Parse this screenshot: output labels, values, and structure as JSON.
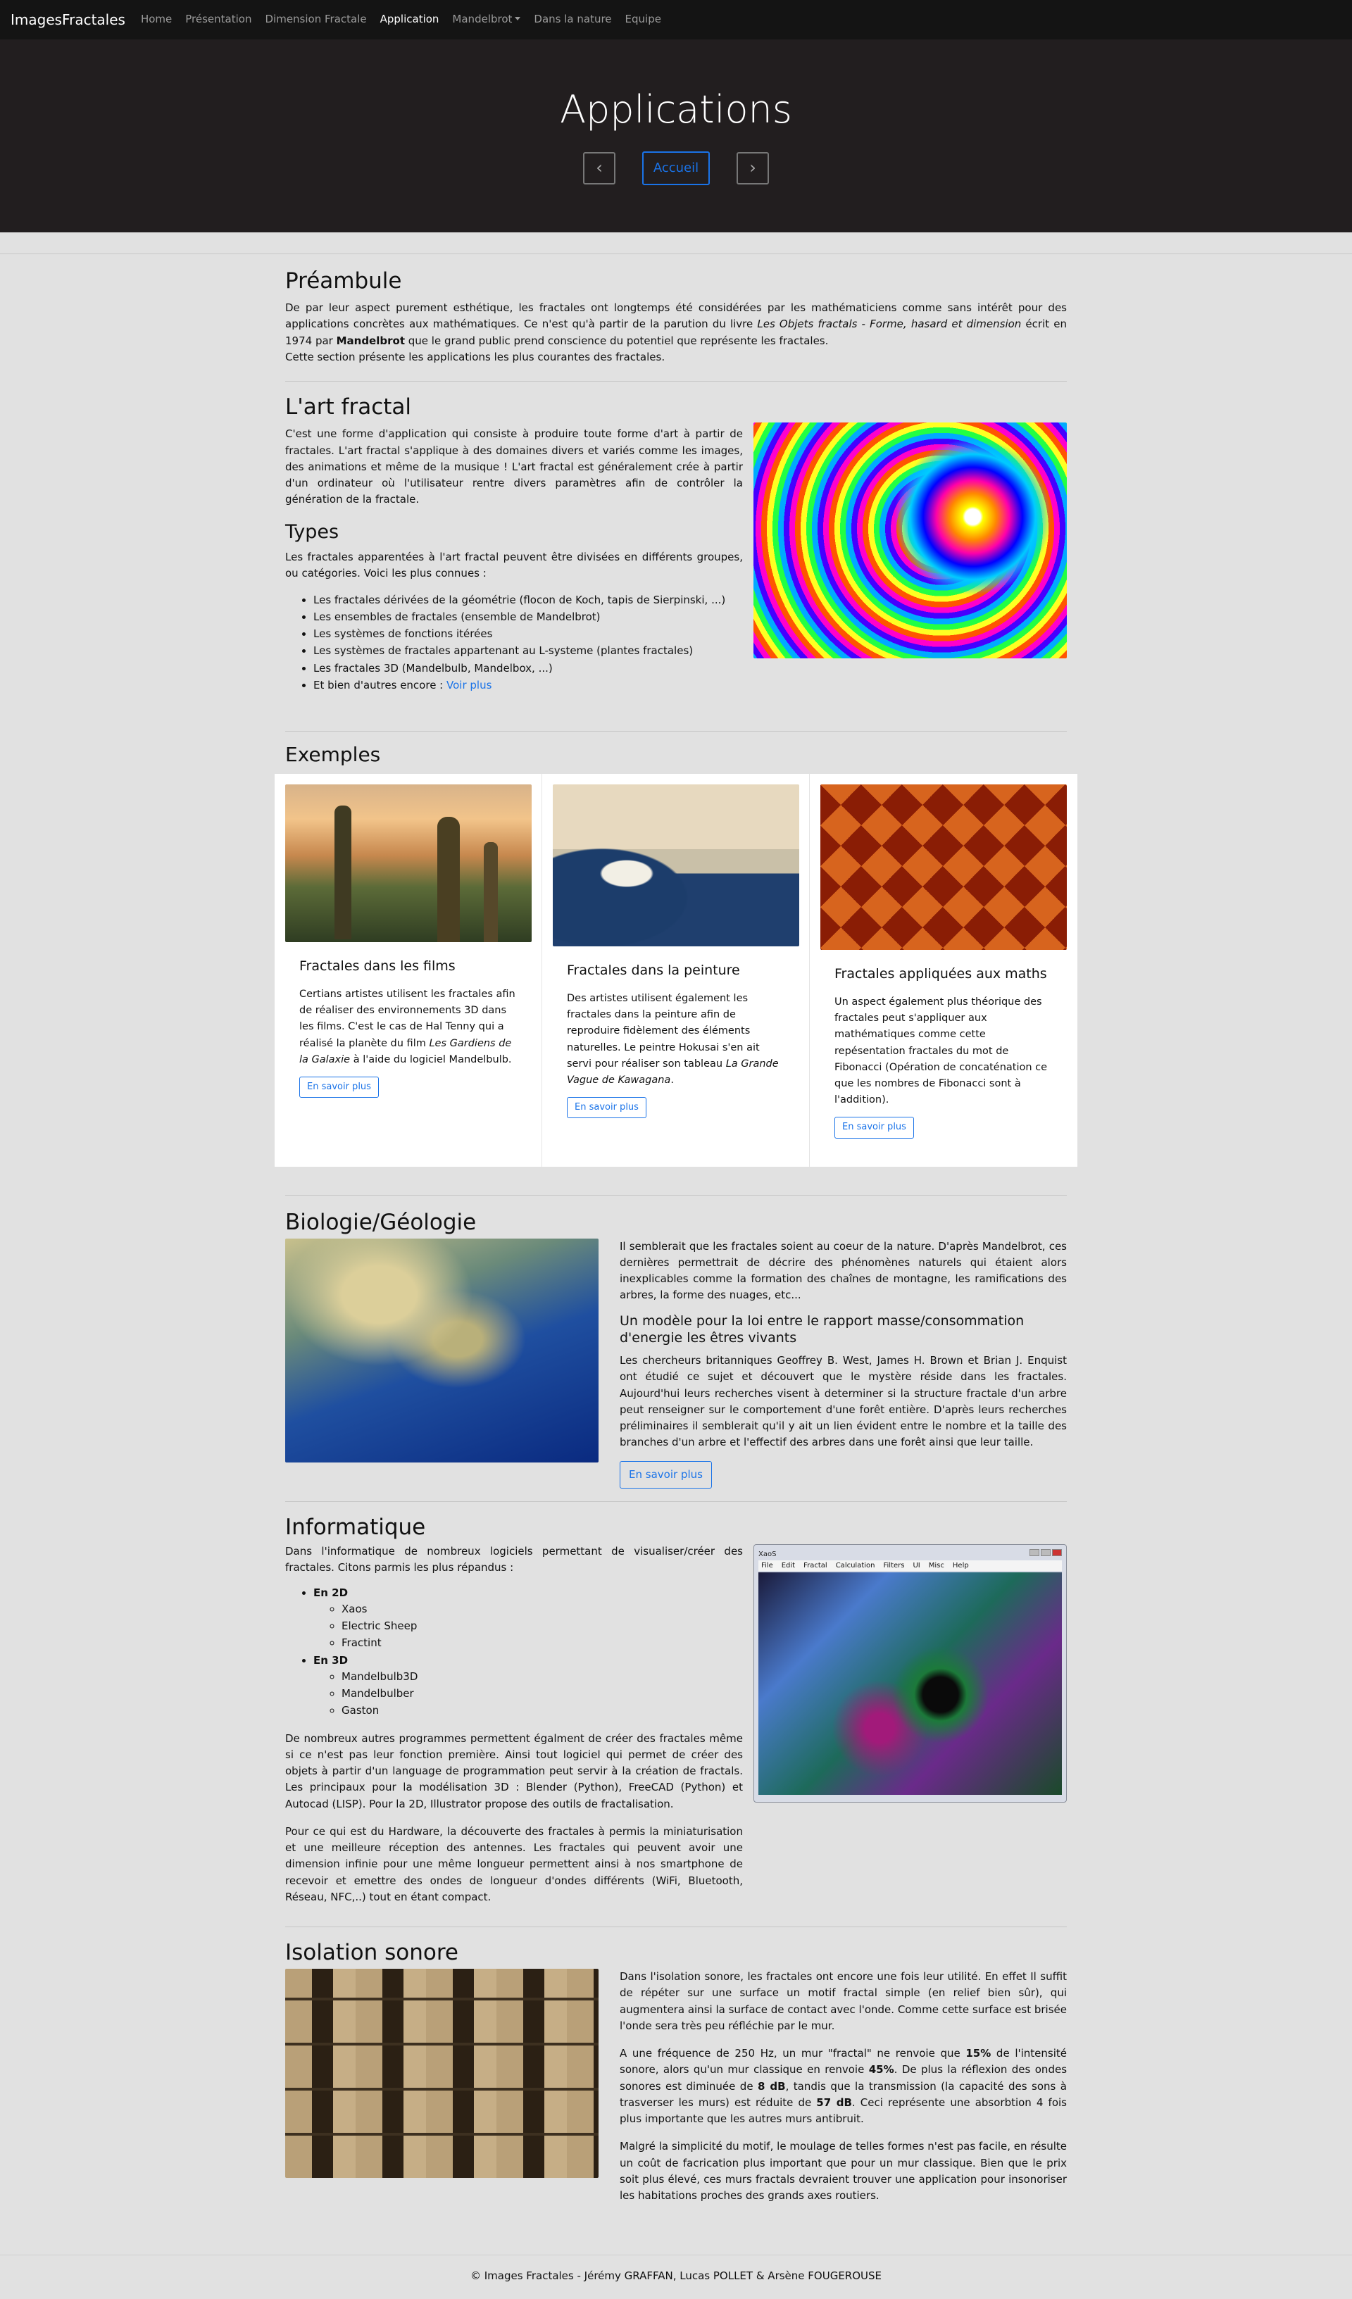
{
  "nav": {
    "brand": "ImagesFractales",
    "items": [
      "Home",
      "Présentation",
      "Dimension Fractale",
      "Application",
      "Mandelbrot",
      "Dans la nature",
      "Equipe"
    ]
  },
  "hero": {
    "title": "Applications",
    "prev": "‹",
    "home": "Accueil",
    "next": "›"
  },
  "preambule": {
    "title": "Préambule",
    "p1_a": "De par leur aspect purement esthétique, les fractales ont longtemps été considérées par les mathématiciens comme sans intérêt pour des applications concrètes aux mathématiques. Ce n'est qu'à partir de la parution du livre ",
    "p1_em": "Les Objets fractals - Forme, hasard et dimension",
    "p1_b": " écrit en 1974 par ",
    "p1_strong": "Mandelbrot",
    "p1_c": " que le grand public prend conscience du potentiel que représente les fractales.",
    "p2": "Cette section présente les applications les plus courantes des fractales."
  },
  "art": {
    "title": "L'art fractal",
    "p": "C'est une forme d'application qui consiste à produire toute forme d'art à partir de fractales. L'art fractal s'applique à des domaines divers et variés comme les images, des animations et même de la musique ! L'art fractal est généralement crée à partir d'un ordinateur où l'utilisateur rentre divers paramètres afin de contrôler la génération de la fractale.",
    "types_title": "Types",
    "types_p": "Les fractales apparentées à l'art fractal peuvent être divisées en différents groupes, ou catégories. Voici les plus connues :",
    "types": [
      "Les fractales dérivées de la géométrie (flocon de Koch, tapis de Sierpinski, ...)",
      "Les ensembles de fractales (ensemble de Mandelbrot)",
      "Les systèmes de fonctions itérées",
      "Les systèmes de fractales appartenant au L-systeme (plantes fractales)",
      "Les fractales 3D (Mandelbulb, Mandelbox, ...)"
    ],
    "more_text": "Et bien d'autres encore : ",
    "more_link": "Voir plus"
  },
  "exemples": {
    "title": "Exemples",
    "button": "En savoir plus",
    "films": {
      "title": "Fractales dans les films",
      "a": "Certians artistes utilisent les fractales afin de réaliser des environnements 3D dans les films. C'est le cas de Hal Tenny qui a réalisé la planète du film ",
      "em": "Les Gardiens de la Galaxie",
      "b": " à l'aide du logiciel Mandelbulb."
    },
    "peinture": {
      "title": "Fractales dans la peinture",
      "a": "Des artistes utilisent également les fractales dans la peinture afin de reproduire fidèlement des éléments naturelles. Le peintre Hokusai s'en ait servi pour réaliser son tableau ",
      "em": "La Grande Vague de Kawagana",
      "b": "."
    },
    "maths": {
      "title": "Fractales appliquées aux maths",
      "p": "Un aspect également plus théorique des fractales peut s'appliquer aux mathématiques comme cette repésentation fractales du mot de Fibonacci (Opération de concaténation ce que les nombres de Fibonacci sont à l'addition)."
    }
  },
  "bio": {
    "title": "Biologie/Géologie",
    "p1": "Il semblerait que les fractales soient au coeur de la nature. D'après Mandelbrot, ces dernières permettrait de décrire des phénomènes naturels qui étaient alors inexplicables comme la formation des chaînes de montagne, les ramifications des arbres, la forme des nuages, etc...",
    "subtitle": "Un modèle pour la loi entre le rapport masse/consommation d'energie les êtres vivants",
    "p2": "Les chercheurs britanniques Geoffrey B. West, James H. Brown et Brian J. Enquist ont étudié ce sujet et découvert que le mystère réside dans les fractales. Aujourd'hui leurs recherches visent à determiner si la structure fractale d'un arbre peut renseigner sur le comportement d'une forêt entière. D'après leurs recherches préliminaires il semblerait qu'il y ait un lien évident entre le nombre et la taille des branches d'un arbre et l'effectif des arbres dans une forêt ainsi que leur taille.",
    "button": "En savoir plus"
  },
  "info": {
    "title": "Informatique",
    "intro": "Dans l'informatique de nombreux logiciels permettant de visualiser/créer des fractales. Citons parmis les plus répandus :",
    "groups": [
      {
        "label": "En 2D",
        "items": [
          "Xaos",
          "Electric Sheep",
          "Fractint"
        ]
      },
      {
        "label": "En 3D",
        "items": [
          "Mandelbulb3D",
          "Mandelbulber",
          "Gaston"
        ]
      }
    ],
    "p2": "De nombreux autres programmes permettent égalment de créer des fractales même si ce n'est pas leur fonction première. Ainsi tout logiciel qui permet de créer des objets à partir d'un language de programmation peut servir à la création de fractals. Les principaux pour la modélisation 3D : Blender (Python), FreeCAD (Python) et Autocad (LISP). Pour la 2D, Illustrator propose des outils de fractalisation.",
    "p3": "Pour ce qui est du Hardware, la découverte des fractales à permis la miniaturisation et une meilleure réception des antennes. Les fractales qui peuvent avoir une dimension infinie pour une même longueur permettent ainsi à nos smartphone de recevoir et emettre des ondes de longueur d'ondes différents (WiFi, Bluetooth, Réseau, NFC,..) tout en étant compact.",
    "xaos_title": "XaoS",
    "xaos_menu": [
      "File",
      "Edit",
      "Fractal",
      "Calculation",
      "Filters",
      "UI",
      "Misc",
      "Help"
    ]
  },
  "sound": {
    "title": "Isolation sonore",
    "p1": "Dans l'isolation sonore, les fractales ont encore une fois leur utilité. En effet Il suffit de répéter sur une surface un motif fractal simple (en relief bien sûr), qui augmentera ainsi la surface de contact avec l'onde. Comme cette surface est brisée l'onde sera très peu réfléchie par le mur.",
    "p2_a": "A une fréquence de 250 Hz, un mur \"fractal\" ne renvoie que ",
    "p2_b1": "15%",
    "p2_c": " de l'intensité sonore, alors qu'un mur classique en renvoie ",
    "p2_b2": "45%",
    "p2_d": ". De plus la réflexion des ondes sonores est diminuée de ",
    "p2_b3": "8 dB",
    "p2_e": ", tandis que la transmission (la capacité des sons à trasverser les murs) est réduite de ",
    "p2_b4": "57 dB",
    "p2_f": ". Ceci représente une absorbtion 4 fois plus importante que les autres murs antibruit.",
    "p3": "Malgré la simplicité du motif, le moulage de telles formes n'est pas facile, en résulte un coût de facrication plus important que pour un mur classique. Bien que le prix soit plus élevé, ces murs fractals devraient trouver une application pour insonoriser les habitations proches des grands axes routiers."
  },
  "footer": {
    "text": "© Images Fractales - Jérémy GRAFFAN, Lucas POLLET & Arsène FOUGEROUSE"
  }
}
